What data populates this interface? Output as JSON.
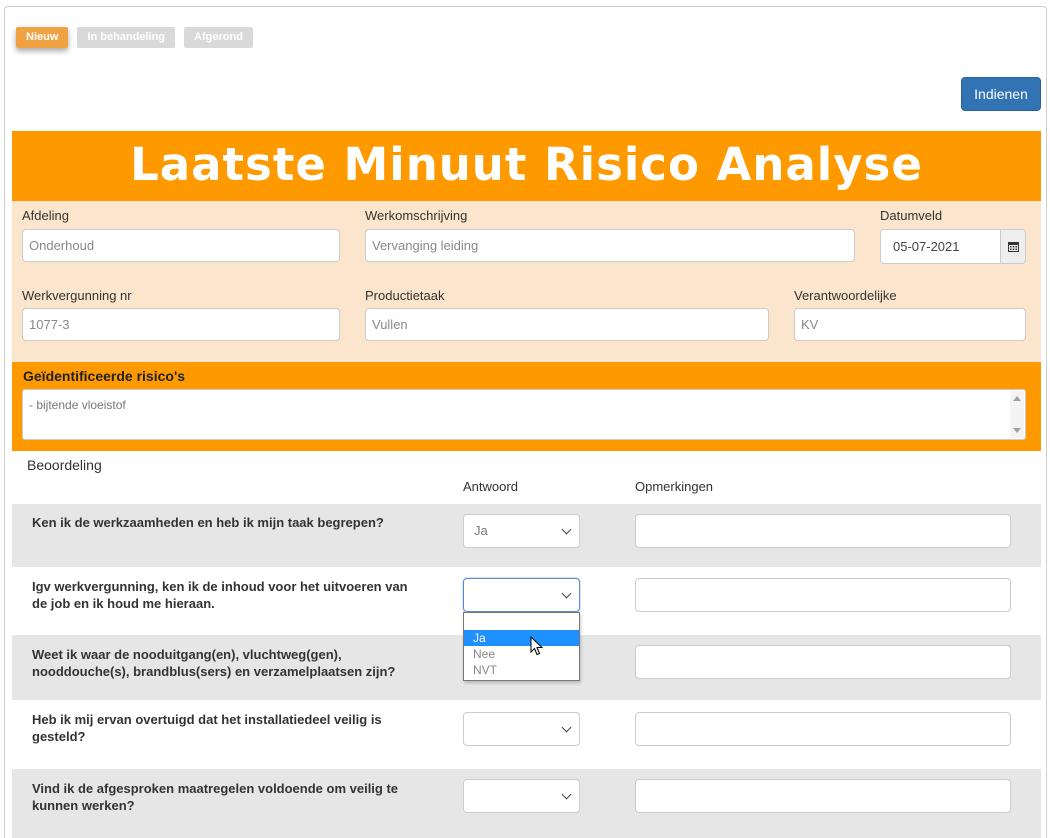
{
  "steps": [
    "Nieuw",
    "In behandeling",
    "Afgerond"
  ],
  "submit_label": "Indienen",
  "title": "Laatste Minuut Risico Analyse",
  "fields": {
    "afdeling": {
      "label": "Afdeling",
      "value": "Onderhoud"
    },
    "werkomschrijving": {
      "label": "Werkomschrijving",
      "value": "Vervanging leiding"
    },
    "datumveld": {
      "label": "Datumveld",
      "value": "05-07-2021"
    },
    "werkvergunning": {
      "label": "Werkvergunning nr",
      "value": "1077-3"
    },
    "productietaak": {
      "label": "Productietaak",
      "value": "Vullen"
    },
    "verantwoordelijke": {
      "label": "Verantwoordelijke",
      "value": "KV"
    }
  },
  "risks": {
    "label": "Geïdentificeerde risico's",
    "value": "- bijtende vloeistof"
  },
  "assessment": {
    "title": "Beoordeling",
    "col_answer": "Antwoord",
    "col_remarks": "Opmerkingen",
    "questions": [
      {
        "text": "Ken ik de werkzaamheden en heb ik mijn taak begrepen?",
        "answer": "Ja"
      },
      {
        "text": "Igv werkvergunning, ken ik de inhoud voor het uitvoeren van de job en ik houd me hieraan.",
        "answer": ""
      },
      {
        "text": "Weet ik waar de nooduitgang(en), vluchtweg(gen), nooddouche(s), brandblus(sers) en verzamelplaatsen zijn?",
        "answer": ""
      },
      {
        "text": "Heb ik mij ervan overtuigd dat het installatiedeel veilig is gesteld?",
        "answer": ""
      },
      {
        "text": "Vind ik de afgesproken maatregelen voldoende om veilig te kunnen werken?",
        "answer": ""
      }
    ]
  },
  "dropdown_options": [
    "",
    "Ja",
    "Nee",
    "NVT"
  ],
  "dropdown_highlighted": "Ja",
  "colors": {
    "orange": "#ff9900",
    "peach": "#fce5cd",
    "primary": "#3273b3",
    "highlight": "#1e90ff"
  }
}
